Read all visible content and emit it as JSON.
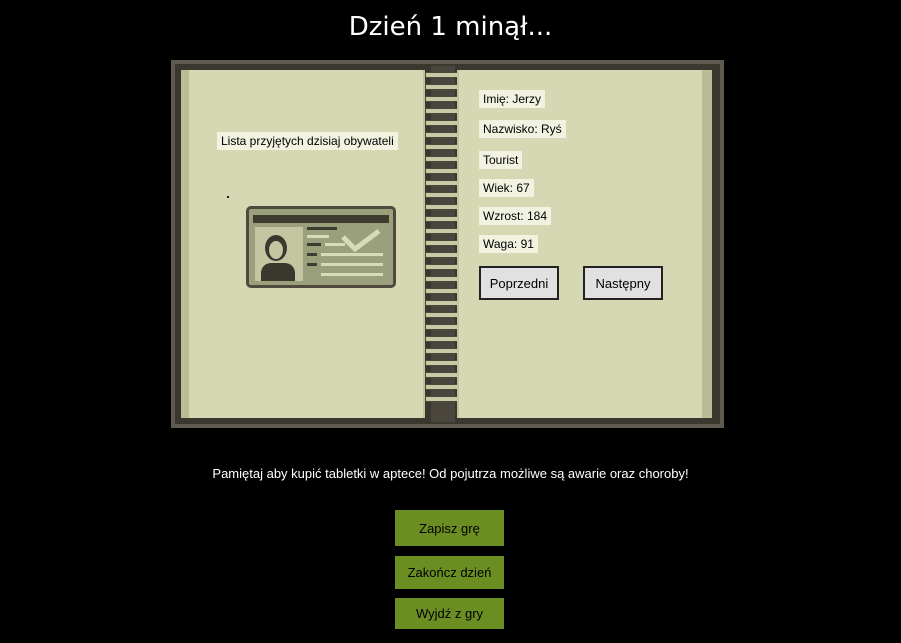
{
  "title": "Dzień 1 minął...",
  "book": {
    "left_page": {
      "list_label": "Lista przyjętych dzisiaj obywateli"
    },
    "citizen": {
      "first_name": "Imię: Jerzy",
      "last_name": "Nazwisko: Ryś",
      "role": "Tourist",
      "age": "Wiek: 67",
      "height": "Wzrost: 184",
      "weight": "Waga: 91"
    },
    "nav": {
      "prev_label": "Poprzedni",
      "next_label": "Następny"
    }
  },
  "notice": "Pamiętaj aby kupić tabletki w aptece! Od pojutrza możliwe są awarie oraz choroby!",
  "actions": {
    "save_label": "Zapisz grę",
    "end_day_label": "Zakończ dzień",
    "exit_label": "Wyjdź z gry"
  },
  "colors": {
    "background": "#000000",
    "page": "#d5d8b3",
    "action_button": "#6b8e23",
    "nav_button": "#e1e1e1"
  },
  "icons": {
    "id_card": "id-card-icon",
    "spiral": "spiral-binding"
  }
}
